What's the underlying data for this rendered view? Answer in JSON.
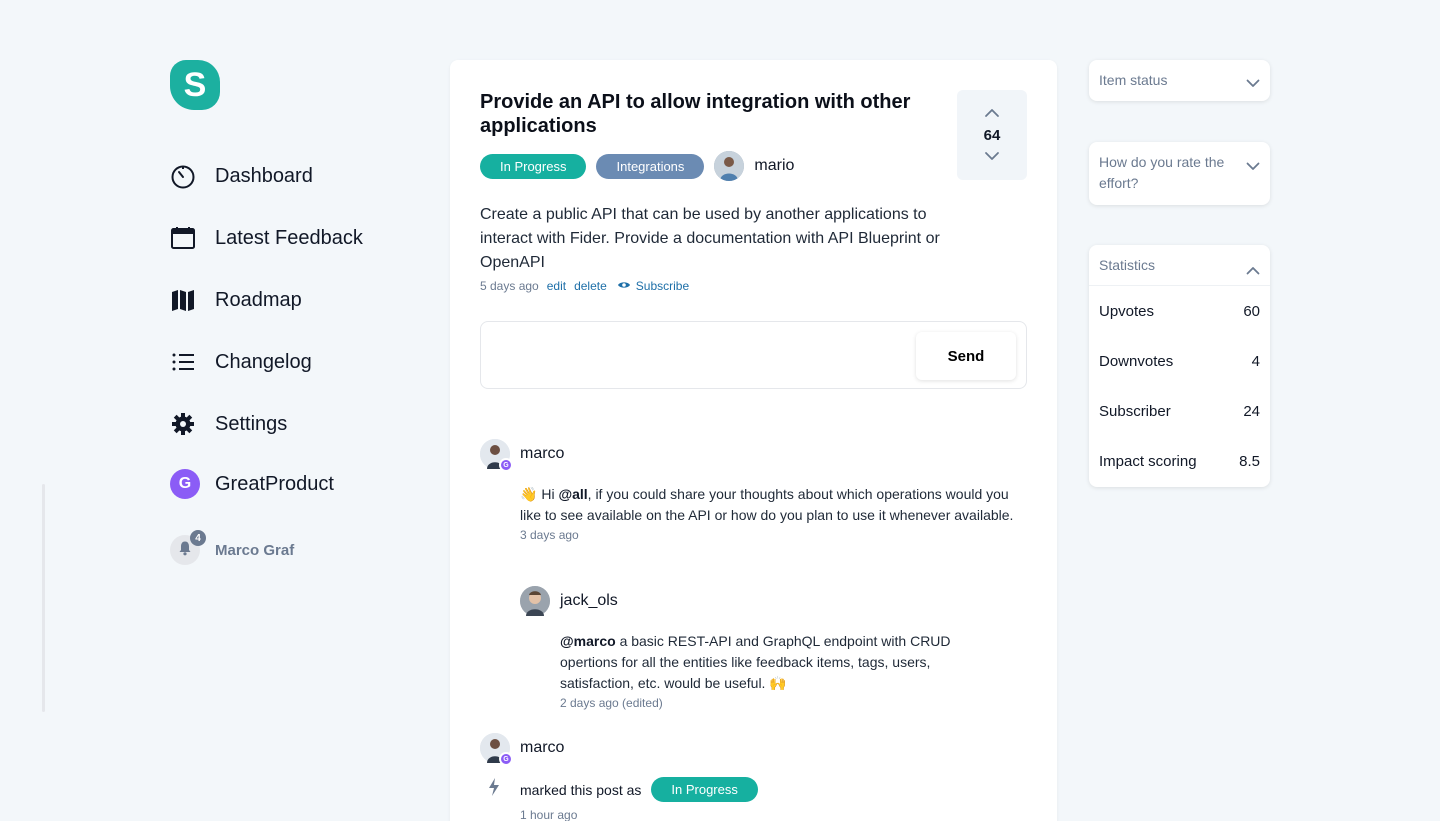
{
  "brand": {
    "logo_letter": "S",
    "accent": "#16b0a0"
  },
  "nav": {
    "items": [
      {
        "label": "Dashboard",
        "icon": "dashboard-gauge-icon"
      },
      {
        "label": "Latest Feedback",
        "icon": "calendar-icon"
      },
      {
        "label": "Roadmap",
        "icon": "map-icon"
      },
      {
        "label": "Changelog",
        "icon": "list-icon"
      },
      {
        "label": "Settings",
        "icon": "gear-icon"
      }
    ],
    "workspace": {
      "label": "GreatProduct",
      "letter": "G"
    }
  },
  "user": {
    "name": "Marco Graf",
    "notifications": "4"
  },
  "post": {
    "title": "Provide an API to allow integration with other applications",
    "status": "In Progress",
    "tag": "Integrations",
    "author": "mario",
    "votes": "64",
    "description": "Create a public API that can be used by another applications to interact with Fider. Provide a documentation with API Blueprint or OpenAPI",
    "time": "5 days ago",
    "edit": "edit",
    "delete": "delete",
    "subscribe": "Subscribe"
  },
  "composer": {
    "placeholder": "",
    "send_label": "Send"
  },
  "comments": [
    {
      "author": "marco",
      "emoji": "👋",
      "pre": "Hi",
      "mention": "@all",
      "text": ", if you could share your thoughts about which operations would you like to see available on the API or how do you plan to use it whenever available.",
      "time": "3 days ago"
    },
    {
      "author": "jack_ols",
      "mention": "@marco",
      "text": "a basic REST-API and GraphQL endpoint with CRUD opertions for all the entities like feedback items, tags, users, satisfaction, etc. would be useful. 🙌",
      "time": "2 days ago (edited)"
    }
  ],
  "status_change": {
    "author": "marco",
    "text": "marked this post as",
    "status": "In Progress",
    "time": "1 hour ago"
  },
  "right": {
    "item_status": "Item status",
    "effort": "How do you rate the effort?",
    "statistics": {
      "title": "Statistics",
      "rows": [
        {
          "label": "Upvotes",
          "value": "60"
        },
        {
          "label": "Downvotes",
          "value": "4"
        },
        {
          "label": "Subscriber",
          "value": "24"
        },
        {
          "label": "Impact scoring",
          "value": "8.5"
        }
      ]
    }
  }
}
